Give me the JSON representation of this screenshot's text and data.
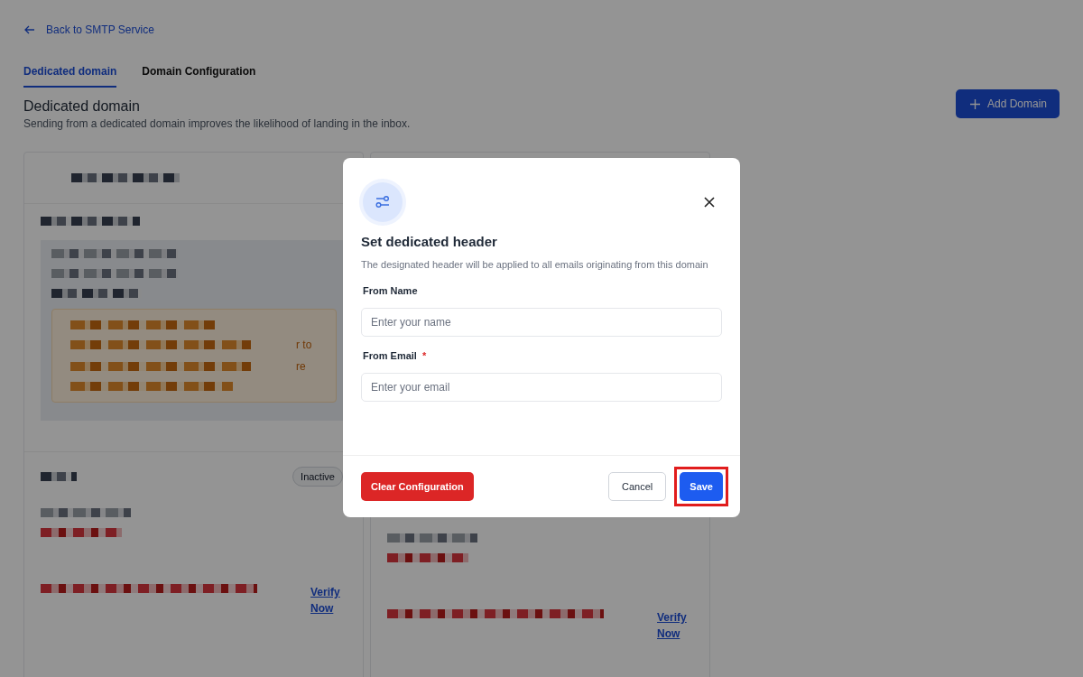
{
  "back_link": {
    "label": "Back to SMTP Service"
  },
  "tabs": [
    {
      "label": "Dedicated domain",
      "selected": true
    },
    {
      "label": "Domain Configuration",
      "selected": false
    }
  ],
  "section": {
    "title": "Dedicated domain",
    "description": "Sending from a dedicated domain improves the likelihood of landing in the inbox.",
    "add_button": "Add Domain"
  },
  "cards": [
    {
      "status": "Inactive",
      "fragments": [
        "r to",
        "re"
      ],
      "verify_link": "Verify Now"
    },
    {
      "verify_link": "Verify Now"
    }
  ],
  "dialog": {
    "title": "Set dedicated header",
    "description": "The designated header will be applied to all emails originating from this domain",
    "fields": [
      {
        "label": "From Name",
        "placeholder": "Enter your name"
      },
      {
        "label": "From Email",
        "required_mark": "*",
        "placeholder": "Enter your email"
      }
    ],
    "buttons": [
      {
        "label": "Clear Configuration",
        "kind": "danger",
        "highlighted": false
      },
      {
        "label": "Cancel",
        "kind": "secondary",
        "highlighted": false
      },
      {
        "label": "Save",
        "kind": "primary",
        "highlighted": true
      }
    ]
  }
}
